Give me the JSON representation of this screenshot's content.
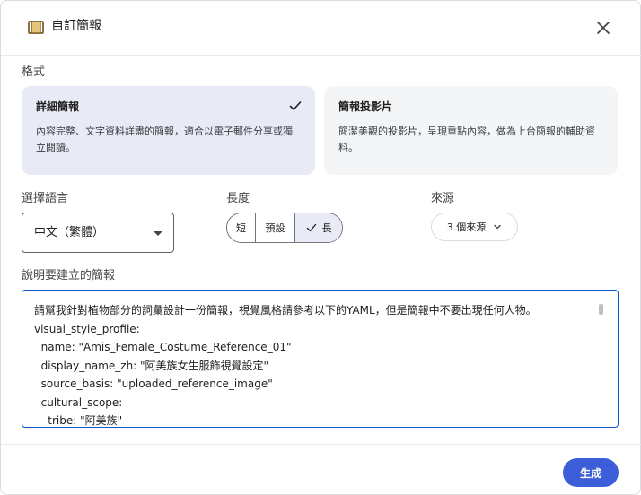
{
  "dialog": {
    "title": "自訂簡報"
  },
  "format": {
    "label": "格式",
    "options": [
      {
        "title": "詳細簡報",
        "desc_line1": "內容完整、文字資料詳盡的簡報，適合以電子郵件分享或獨",
        "desc_line2": "立閱讀。",
        "selected": true
      },
      {
        "title": "簡報投影片",
        "desc_line1": "簡潔美觀的投影片，呈現重點內容，做為上台簡報的輔助資",
        "desc_line2": "料。",
        "selected": false
      }
    ]
  },
  "language": {
    "label": "選擇語言",
    "value": "中文（繁體）"
  },
  "length": {
    "label": "長度",
    "options": [
      "短",
      "預設",
      "長"
    ],
    "selected": "長"
  },
  "source": {
    "label": "來源",
    "button": "3 個來源"
  },
  "prompt": {
    "label": "說明要建立的簡報",
    "lines": [
      "請幫我針對植物部分的詞彙設計一份簡報，視覺風格請參考以下的YAML，但是簡報中不要出現任何人物。",
      "visual_style_profile:",
      "  name: \"Amis_Female_Costume_Reference_01\"",
      "  display_name_zh: \"阿美族女生服飾視覺設定\"",
      "  source_basis: \"uploaded_reference_image\"",
      "  cultural_scope:",
      "    tribe: \"阿美族\""
    ]
  },
  "actions": {
    "generate": "生成"
  },
  "colors": {
    "accent": "#3c5ed8",
    "selected_card": "#e8eaf6",
    "focus_border": "#0b57d0"
  },
  "icons": {
    "title": "slides-doc-icon",
    "close": "close-icon",
    "check": "check-icon",
    "dropdown": "dropdown-caret-icon",
    "chevron": "chevron-down-icon"
  }
}
